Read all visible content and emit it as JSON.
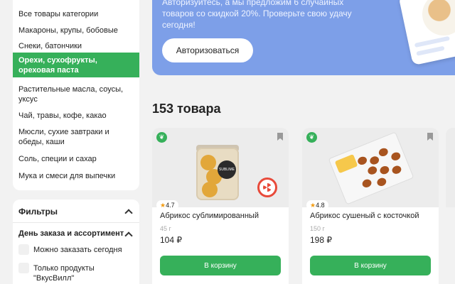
{
  "sidebar": {
    "categories": [
      {
        "label": "Все товары категории",
        "active": false
      },
      {
        "label": "Макароны, крупы, бобовые",
        "active": false
      },
      {
        "label": "Снеки, батончики",
        "active": false
      },
      {
        "label": "Орехи, сухофрукты, ореховая паста",
        "active": true
      },
      {
        "label": "Растительные масла, соусы, уксус",
        "active": false
      },
      {
        "label": "Чай, травы, кофе, какао",
        "active": false
      },
      {
        "label": "Мюсли, сухие завтраки и обеды, каши",
        "active": false
      },
      {
        "label": "Соль, специи и сахар",
        "active": false
      },
      {
        "label": "Мука и смеси для выпечки",
        "active": false
      }
    ],
    "filters": {
      "title": "Фильтры",
      "section_title": "День заказа и ассортимент",
      "options": [
        "Можно заказать сегодня",
        "Только продукты \"ВкусВилл\""
      ]
    }
  },
  "banner": {
    "text": "Авторизуйтесь, а мы предложим 6 случайных товаров со скидкой 20%. Проверьте свою удачу сегодня!",
    "button_label": "Авторизоваться"
  },
  "catalog": {
    "count_title": "153 товара",
    "products": [
      {
        "name": "Абрикос сублимированный",
        "weight": "45 г",
        "price": "104 ₽",
        "rating": "4.7",
        "cart_label": "В корзину",
        "jar_label": "SUBLIME"
      },
      {
        "name": "Абрикос сушеный с косточкой",
        "weight": "150 г",
        "price": "198 ₽",
        "rating": "4.8",
        "cart_label": "В корзину"
      }
    ]
  },
  "colors": {
    "accent_green": "#36b05a",
    "banner_blue": "#7d9fe8",
    "star": "#f39c12"
  }
}
